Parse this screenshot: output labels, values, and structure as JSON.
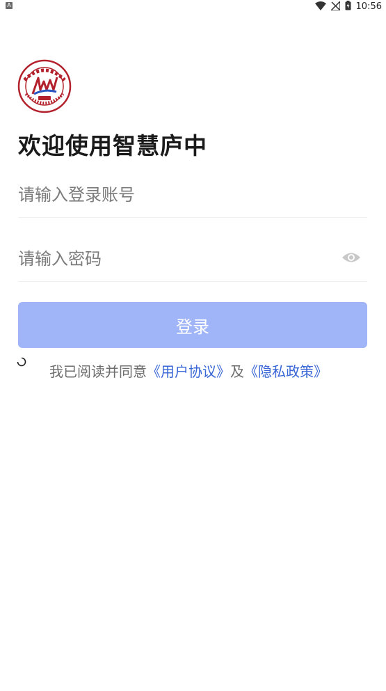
{
  "status_bar": {
    "left_icon": "a-notification-icon",
    "time": "10:56",
    "icons": [
      "wifi-icon",
      "no-signal-icon",
      "battery-icon"
    ]
  },
  "logo": {
    "top_text": "安徽省庐江中学",
    "year": "1903",
    "bottom_text": "ANHUI SHENG LUJIANG ZHONGXUE"
  },
  "title": "欢迎使用智慧庐中",
  "account": {
    "value": "",
    "placeholder": "请输入登录账号"
  },
  "password": {
    "value": "",
    "placeholder": "请输入密码"
  },
  "login_button": "登录",
  "agreement": {
    "prefix": "我已阅读并同意",
    "user_agreement": "《用户协议》",
    "and": "及",
    "privacy_policy": "《隐私政策》"
  },
  "colors": {
    "primary_disabled": "#a0b4f8",
    "link": "#3a67d6",
    "logo_red": "#b3222c"
  }
}
